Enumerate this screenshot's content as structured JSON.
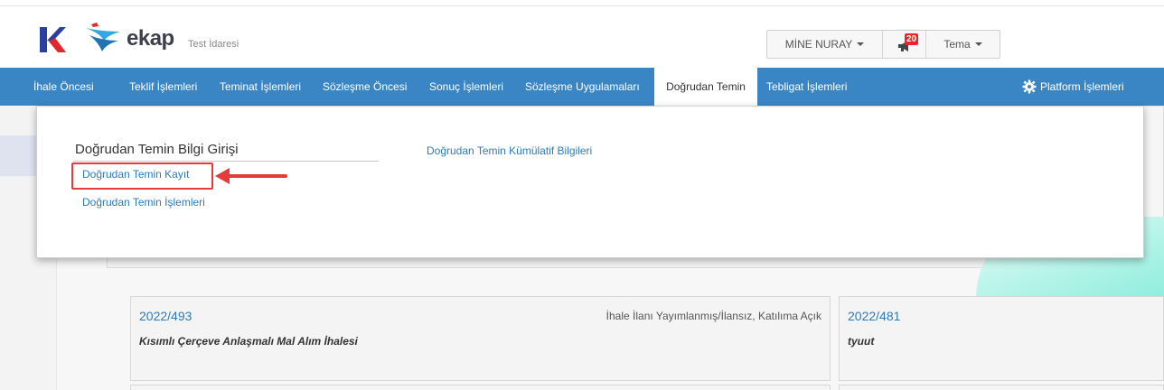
{
  "header": {
    "logo_text": "ekap",
    "org_name": "Test İdaresi",
    "user_name": "MİNE NURAY",
    "notification_count": "20",
    "theme_label": "Tema"
  },
  "nav": {
    "items": [
      "İhale Öncesi",
      "Teklif İşlemleri",
      "Teminat İşlemleri",
      "Sözleşme Öncesi",
      "Sonuç İşlemleri",
      "Sözleşme Uygulamaları",
      "Doğrudan Temin",
      "Tebligat İşlemleri"
    ],
    "active_item": "Doğrudan Temin",
    "platform_label": "Platform İşlemleri"
  },
  "dropdown": {
    "heading": "Doğrudan Temin Bilgi Girişi",
    "links": [
      "Doğrudan Temin Kayıt",
      "Doğrudan Temin İşlemleri"
    ],
    "right_link": "Doğrudan Temin Kümülatif Bilgileri",
    "highlighted_link": "Doğrudan Temin Kayıt"
  },
  "cards": [
    {
      "id": "2022/493",
      "status": "İhale İlanı Yayımlanmış/İlansız, Katılıma Açık",
      "title": "Kısımlı Çerçeve Anlaşmalı Mal Alım İhalesi"
    },
    {
      "id": "2022/481",
      "status": "",
      "title": "tyuut"
    }
  ],
  "colors": {
    "nav_bg": "#3a86c4",
    "link": "#2c7bbd",
    "highlight": "#e43b3b",
    "badge": "#e8262a"
  },
  "icons": {
    "notification": "megaphone-icon",
    "platform": "gear-icon",
    "annotation": "arrow-left-icon"
  }
}
